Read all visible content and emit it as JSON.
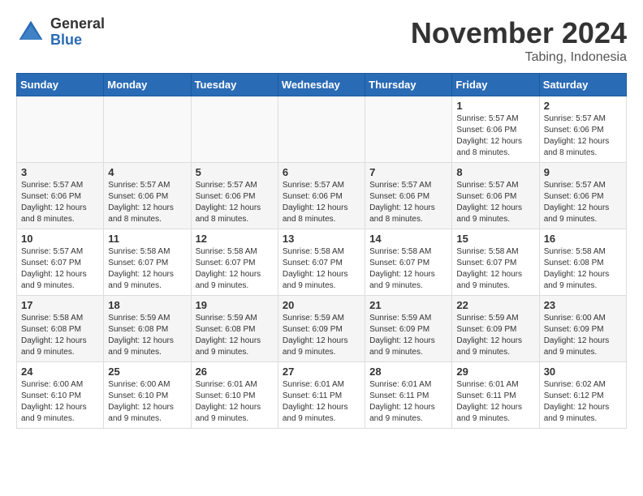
{
  "logo": {
    "general": "General",
    "blue": "Blue"
  },
  "title": "November 2024",
  "location": "Tabing, Indonesia",
  "days_header": [
    "Sunday",
    "Monday",
    "Tuesday",
    "Wednesday",
    "Thursday",
    "Friday",
    "Saturday"
  ],
  "weeks": [
    [
      {
        "day": "",
        "detail": ""
      },
      {
        "day": "",
        "detail": ""
      },
      {
        "day": "",
        "detail": ""
      },
      {
        "day": "",
        "detail": ""
      },
      {
        "day": "",
        "detail": ""
      },
      {
        "day": "1",
        "detail": "Sunrise: 5:57 AM\nSunset: 6:06 PM\nDaylight: 12 hours and 8 minutes."
      },
      {
        "day": "2",
        "detail": "Sunrise: 5:57 AM\nSunset: 6:06 PM\nDaylight: 12 hours and 8 minutes."
      }
    ],
    [
      {
        "day": "3",
        "detail": "Sunrise: 5:57 AM\nSunset: 6:06 PM\nDaylight: 12 hours and 8 minutes."
      },
      {
        "day": "4",
        "detail": "Sunrise: 5:57 AM\nSunset: 6:06 PM\nDaylight: 12 hours and 8 minutes."
      },
      {
        "day": "5",
        "detail": "Sunrise: 5:57 AM\nSunset: 6:06 PM\nDaylight: 12 hours and 8 minutes."
      },
      {
        "day": "6",
        "detail": "Sunrise: 5:57 AM\nSunset: 6:06 PM\nDaylight: 12 hours and 8 minutes."
      },
      {
        "day": "7",
        "detail": "Sunrise: 5:57 AM\nSunset: 6:06 PM\nDaylight: 12 hours and 8 minutes."
      },
      {
        "day": "8",
        "detail": "Sunrise: 5:57 AM\nSunset: 6:06 PM\nDaylight: 12 hours and 9 minutes."
      },
      {
        "day": "9",
        "detail": "Sunrise: 5:57 AM\nSunset: 6:06 PM\nDaylight: 12 hours and 9 minutes."
      }
    ],
    [
      {
        "day": "10",
        "detail": "Sunrise: 5:57 AM\nSunset: 6:07 PM\nDaylight: 12 hours and 9 minutes."
      },
      {
        "day": "11",
        "detail": "Sunrise: 5:58 AM\nSunset: 6:07 PM\nDaylight: 12 hours and 9 minutes."
      },
      {
        "day": "12",
        "detail": "Sunrise: 5:58 AM\nSunset: 6:07 PM\nDaylight: 12 hours and 9 minutes."
      },
      {
        "day": "13",
        "detail": "Sunrise: 5:58 AM\nSunset: 6:07 PM\nDaylight: 12 hours and 9 minutes."
      },
      {
        "day": "14",
        "detail": "Sunrise: 5:58 AM\nSunset: 6:07 PM\nDaylight: 12 hours and 9 minutes."
      },
      {
        "day": "15",
        "detail": "Sunrise: 5:58 AM\nSunset: 6:07 PM\nDaylight: 12 hours and 9 minutes."
      },
      {
        "day": "16",
        "detail": "Sunrise: 5:58 AM\nSunset: 6:08 PM\nDaylight: 12 hours and 9 minutes."
      }
    ],
    [
      {
        "day": "17",
        "detail": "Sunrise: 5:58 AM\nSunset: 6:08 PM\nDaylight: 12 hours and 9 minutes."
      },
      {
        "day": "18",
        "detail": "Sunrise: 5:59 AM\nSunset: 6:08 PM\nDaylight: 12 hours and 9 minutes."
      },
      {
        "day": "19",
        "detail": "Sunrise: 5:59 AM\nSunset: 6:08 PM\nDaylight: 12 hours and 9 minutes."
      },
      {
        "day": "20",
        "detail": "Sunrise: 5:59 AM\nSunset: 6:09 PM\nDaylight: 12 hours and 9 minutes."
      },
      {
        "day": "21",
        "detail": "Sunrise: 5:59 AM\nSunset: 6:09 PM\nDaylight: 12 hours and 9 minutes."
      },
      {
        "day": "22",
        "detail": "Sunrise: 5:59 AM\nSunset: 6:09 PM\nDaylight: 12 hours and 9 minutes."
      },
      {
        "day": "23",
        "detail": "Sunrise: 6:00 AM\nSunset: 6:09 PM\nDaylight: 12 hours and 9 minutes."
      }
    ],
    [
      {
        "day": "24",
        "detail": "Sunrise: 6:00 AM\nSunset: 6:10 PM\nDaylight: 12 hours and 9 minutes."
      },
      {
        "day": "25",
        "detail": "Sunrise: 6:00 AM\nSunset: 6:10 PM\nDaylight: 12 hours and 9 minutes."
      },
      {
        "day": "26",
        "detail": "Sunrise: 6:01 AM\nSunset: 6:10 PM\nDaylight: 12 hours and 9 minutes."
      },
      {
        "day": "27",
        "detail": "Sunrise: 6:01 AM\nSunset: 6:11 PM\nDaylight: 12 hours and 9 minutes."
      },
      {
        "day": "28",
        "detail": "Sunrise: 6:01 AM\nSunset: 6:11 PM\nDaylight: 12 hours and 9 minutes."
      },
      {
        "day": "29",
        "detail": "Sunrise: 6:01 AM\nSunset: 6:11 PM\nDaylight: 12 hours and 9 minutes."
      },
      {
        "day": "30",
        "detail": "Sunrise: 6:02 AM\nSunset: 6:12 PM\nDaylight: 12 hours and 9 minutes."
      }
    ]
  ]
}
